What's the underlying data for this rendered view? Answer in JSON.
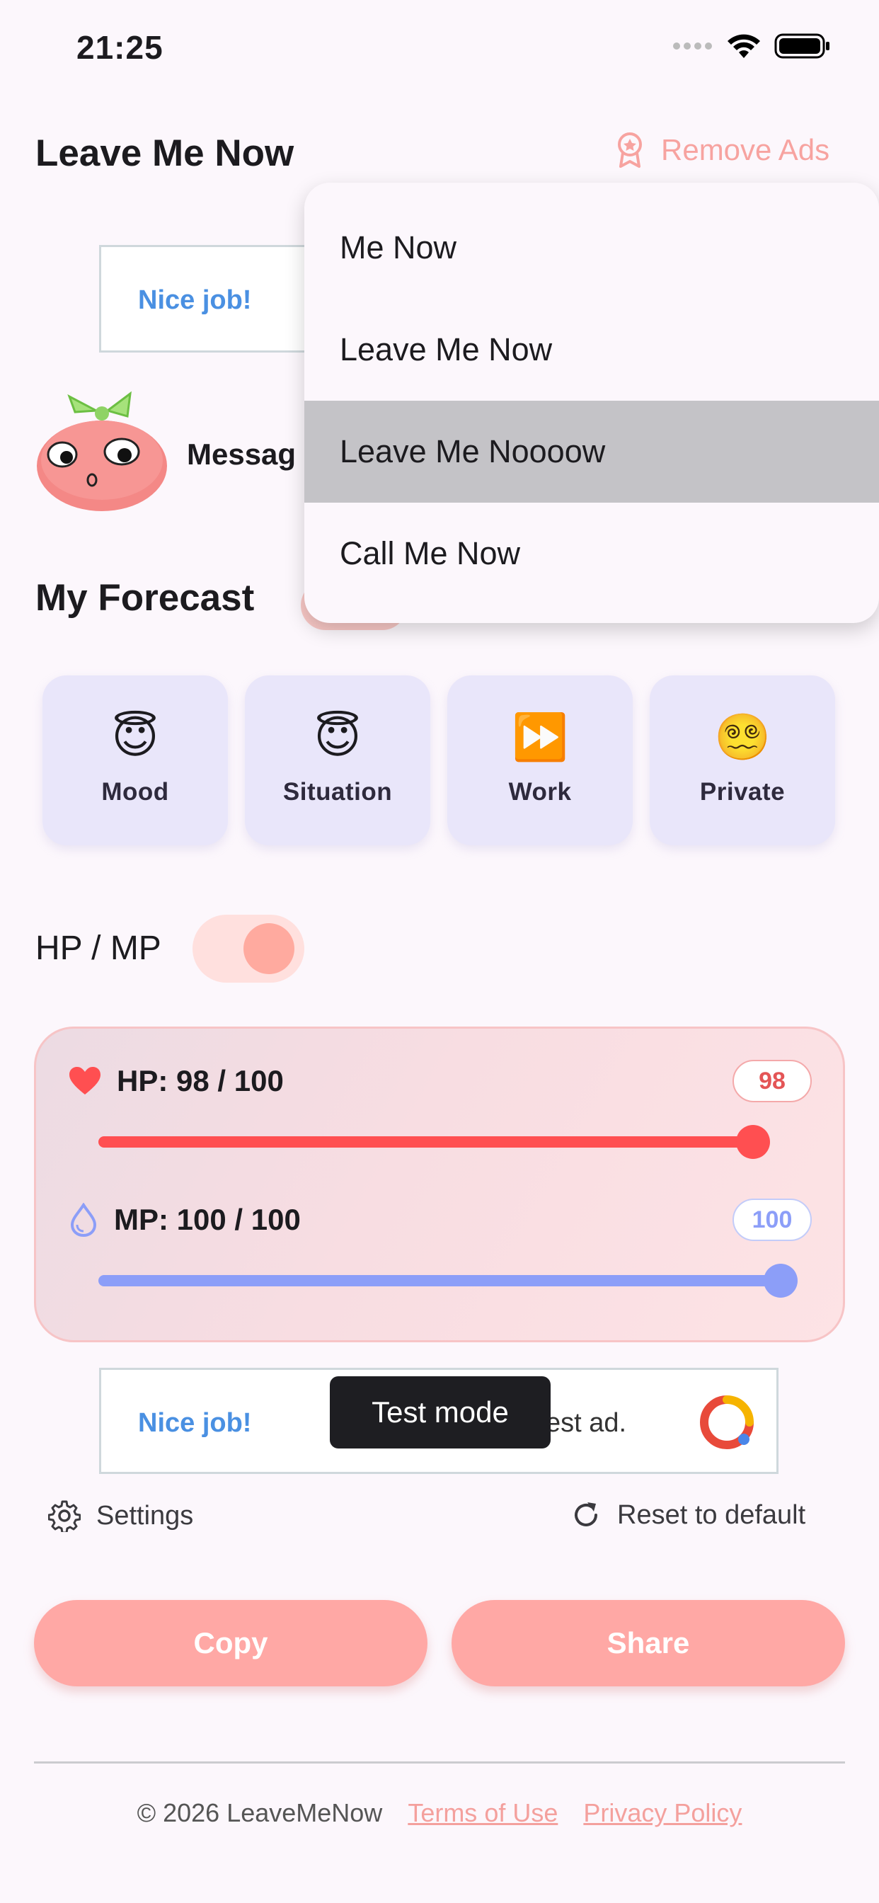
{
  "status": {
    "time": "21:25"
  },
  "header": {
    "title": "Leave Me Now",
    "remove_ads": "Remove Ads"
  },
  "ad_top": {
    "text": "Nice job!"
  },
  "message": {
    "label": "Messag"
  },
  "forecast": {
    "title": "My Forecast",
    "cards": [
      {
        "emoji": "😇",
        "label": "Mood"
      },
      {
        "emoji": "😇",
        "label": "Situation"
      },
      {
        "emoji": "⏩",
        "label": "Work"
      },
      {
        "emoji": "😵‍💫",
        "label": "Private"
      }
    ]
  },
  "hpmp": {
    "label": "HP / MP",
    "enabled": true
  },
  "stats": {
    "hp": {
      "label": "HP: 98 / 100",
      "badge": "98",
      "value": 98,
      "max": 100,
      "color": "#ff4f51"
    },
    "mp": {
      "label": "MP: 100 / 100",
      "badge": "100",
      "value": 100,
      "max": 100,
      "color": "#8c9ef8"
    }
  },
  "ad_bottom": {
    "text": "Nice job!",
    "suffix": "est ad."
  },
  "toast": {
    "text": "Test mode"
  },
  "links": {
    "settings": "Settings",
    "reset": "Reset to default"
  },
  "buttons": {
    "copy": "Copy",
    "share": "Share"
  },
  "footer": {
    "copyright": "© 2026 LeaveMeNow",
    "terms": "Terms of Use",
    "privacy": "Privacy Policy"
  },
  "menu": {
    "items": [
      "Me Now",
      "Leave Me Now",
      "Leave Me Noooow",
      "Call Me Now"
    ],
    "highlighted_index": 2
  },
  "colors": {
    "accent": "#ffa8a5",
    "hp": "#ff4f51",
    "mp": "#8c9ef8",
    "card_bg": "#e9e6fa"
  }
}
